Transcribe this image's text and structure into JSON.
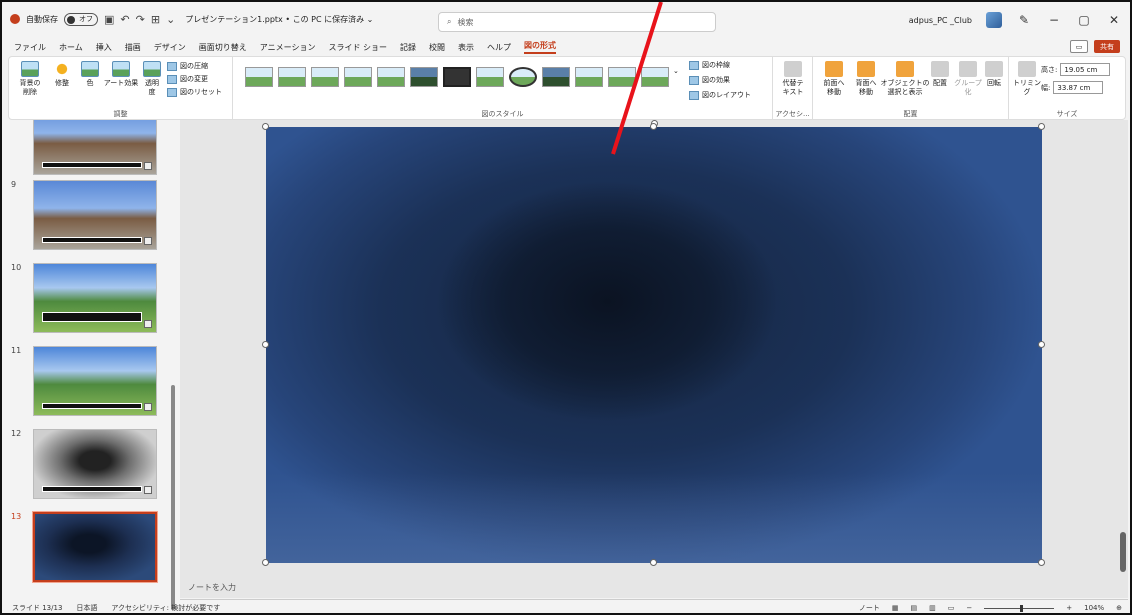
{
  "titlebar": {
    "autosave_label": "自動保存",
    "autosave_state": "オフ",
    "doc_title": "プレゼンテーション1.pptx • この PC に保存済み ⌄",
    "search_placeholder": "検索",
    "user_name": "adpus_PC _Club"
  },
  "tabs": [
    "ファイル",
    "ホーム",
    "挿入",
    "描画",
    "デザイン",
    "画面切り替え",
    "アニメーション",
    "スライド ショー",
    "記録",
    "校閲",
    "表示",
    "ヘルプ",
    "図の形式"
  ],
  "tabs_right": {
    "share_label": "共有"
  },
  "ribbon": {
    "adjust": {
      "remove_bg": "背景の\n削除",
      "corrections": "修整",
      "color": "色",
      "artistic": "アート効果",
      "transparency": "透明\n度",
      "compress": "図の圧縮",
      "change": "図の変更",
      "reset": "図のリセット",
      "group_label": "調整"
    },
    "styles": {
      "border": "図の枠線",
      "effects": "図の効果",
      "layout": "図のレイアウト",
      "group_label": "図のスタイル"
    },
    "accessibility": {
      "alt_text": "代替テ\nキスト",
      "group_label": "アクセシ..."
    },
    "arrange": {
      "forward": "前面へ\n移動",
      "backward": "背面へ\n移動",
      "selection": "オブジェクトの\n選択と表示",
      "align": "配置",
      "group": "グループ化",
      "rotate": "回転",
      "group_label": "配置"
    },
    "size": {
      "crop": "トリミング",
      "height_label": "高さ:",
      "height_value": "19.05 cm",
      "width_label": "幅:",
      "width_value": "33.87 cm",
      "group_label": "サイズ"
    }
  },
  "slides": [
    {
      "num": "",
      "bg": "village"
    },
    {
      "num": "9",
      "bg": "village"
    },
    {
      "num": "10",
      "bg": "meadow"
    },
    {
      "num": "11",
      "bg": "meadow"
    },
    {
      "num": "12",
      "bg": "tunnel"
    },
    {
      "num": "13",
      "bg": "vortex",
      "selected": true
    }
  ],
  "notes_placeholder": "ノートを入力",
  "status": {
    "slide_indicator": "スライド 13/13",
    "language": "日本語",
    "accessibility": "アクセシビリティ: 検討が必要です",
    "notes": "ノート",
    "zoom": "104%"
  },
  "colors": {
    "accent": "#c43e1c",
    "annotation_arrow": "#e8131b"
  }
}
